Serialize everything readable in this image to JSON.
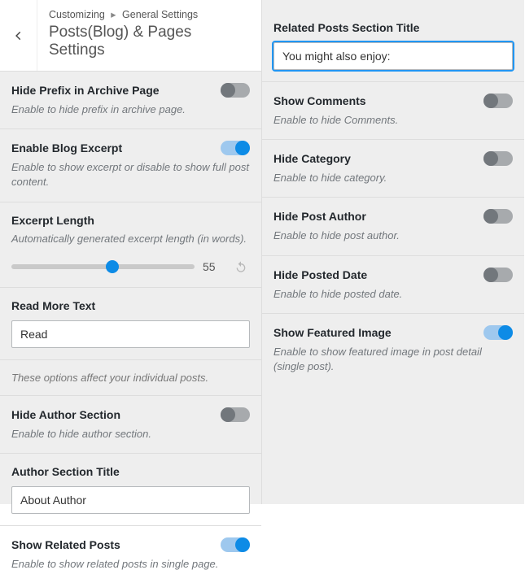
{
  "breadcrumb": {
    "root": "Customizing",
    "parent": "General Settings"
  },
  "title": "Posts(Blog) & Pages Settings",
  "left": {
    "hidePrefix": {
      "label": "Hide Prefix in Archive Page",
      "desc": "Enable to hide prefix in archive page.",
      "value": false
    },
    "blogExcerpt": {
      "label": "Enable Blog Excerpt",
      "desc": "Enable to show excerpt or disable to show full post content.",
      "value": true
    },
    "excerptLength": {
      "label": "Excerpt Length",
      "desc": "Automatically generated excerpt length (in words).",
      "value": 55,
      "min": 0,
      "max": 100
    },
    "readMore": {
      "label": "Read More Text",
      "value": "Read"
    },
    "individualHelp": "These options affect your individual posts.",
    "hideAuthor": {
      "label": "Hide Author Section",
      "desc": "Enable to hide author section.",
      "value": false
    },
    "authorTitle": {
      "label": "Author Section Title",
      "value": "About Author"
    },
    "related": {
      "label": "Show Related Posts",
      "desc": "Enable to show related posts in single page.",
      "value": true
    }
  },
  "right": {
    "relatedTitle": {
      "label": "Related Posts Section Title",
      "value": "You might also enjoy:"
    },
    "showComments": {
      "label": "Show Comments",
      "desc": "Enable to hide Comments.",
      "value": false
    },
    "hideCategory": {
      "label": "Hide Category",
      "desc": "Enable to hide category.",
      "value": false
    },
    "hidePostAuthor": {
      "label": "Hide Post Author",
      "desc": "Enable to hide post author.",
      "value": false
    },
    "hidePostedDate": {
      "label": "Hide Posted Date",
      "desc": "Enable to hide posted date.",
      "value": false
    },
    "featuredImage": {
      "label": "Show Featured Image",
      "desc": "Enable to show featured image in post detail (single post).",
      "value": true
    }
  }
}
